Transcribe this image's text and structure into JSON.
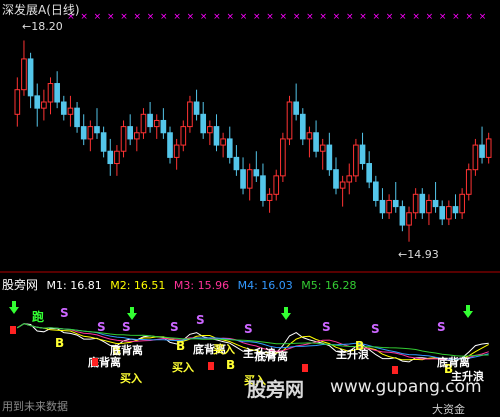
{
  "header": {
    "title": "深发展A(日线)"
  },
  "price_panel": {
    "high_label": "18.20",
    "low_label": "14.93",
    "x_marks_color": "#ff00ff"
  },
  "ma_legend": {
    "panel_name": "股旁网",
    "items": [
      {
        "label": "M1: 16.81",
        "color": "#ffffff"
      },
      {
        "label": "M2: 16.51",
        "color": "#ffff00"
      },
      {
        "label": "M3: 15.96",
        "color": "#ff3399"
      },
      {
        "label": "M4: 16.03",
        "color": "#3399ff"
      },
      {
        "label": "M5: 16.28",
        "color": "#33cc33"
      }
    ]
  },
  "signals": {
    "labels": [
      "跑",
      "S",
      "S",
      "S",
      "S",
      "S",
      "S",
      "S",
      "S",
      "S",
      "B",
      "B",
      "B",
      "B",
      "B",
      "B",
      "底背离",
      "底背离",
      "底背离",
      "底背离",
      "底背离",
      "主升浪",
      "主升浪",
      "主升浪",
      "买入",
      "买入",
      "买入",
      "买入"
    ]
  },
  "watermark": {
    "brand": "股旁网",
    "url": "www.gupang.com"
  },
  "footer": {
    "left_text": "用到未来数据",
    "right_text": "大资金"
  },
  "colors": {
    "up": "#ff3333",
    "down": "#54c6ea",
    "background": "#000000"
  },
  "chart_data": {
    "type": "candlestick",
    "title": "深发展A(日线)",
    "annotations": [
      {
        "text": "18.20",
        "kind": "high"
      },
      {
        "text": "14.93",
        "kind": "low"
      }
    ],
    "ylim": [
      14.6,
      18.5
    ],
    "candles": [
      [
        17.0,
        17.6,
        16.8,
        17.4
      ],
      [
        17.4,
        18.2,
        17.3,
        17.9
      ],
      [
        17.9,
        18.0,
        17.1,
        17.3
      ],
      [
        17.3,
        17.5,
        16.8,
        17.1
      ],
      [
        17.1,
        17.4,
        16.9,
        17.2
      ],
      [
        17.2,
        17.6,
        17.0,
        17.5
      ],
      [
        17.5,
        17.7,
        17.1,
        17.2
      ],
      [
        17.2,
        17.3,
        16.9,
        17.0
      ],
      [
        17.0,
        17.3,
        16.8,
        17.1
      ],
      [
        17.1,
        17.2,
        16.7,
        16.8
      ],
      [
        16.8,
        17.0,
        16.5,
        16.6
      ],
      [
        16.6,
        16.9,
        16.4,
        16.8
      ],
      [
        16.8,
        17.1,
        16.6,
        16.7
      ],
      [
        16.7,
        16.8,
        16.3,
        16.4
      ],
      [
        16.4,
        16.6,
        16.0,
        16.2
      ],
      [
        16.2,
        16.5,
        16.0,
        16.4
      ],
      [
        16.4,
        16.9,
        16.3,
        16.8
      ],
      [
        16.8,
        17.0,
        16.5,
        16.6
      ],
      [
        16.6,
        16.8,
        16.4,
        16.7
      ],
      [
        16.7,
        17.1,
        16.6,
        17.0
      ],
      [
        17.0,
        17.2,
        16.7,
        16.8
      ],
      [
        16.8,
        17.0,
        16.6,
        16.9
      ],
      [
        16.9,
        17.1,
        16.6,
        16.7
      ],
      [
        16.7,
        16.8,
        16.2,
        16.3
      ],
      [
        16.3,
        16.6,
        16.1,
        16.5
      ],
      [
        16.5,
        16.9,
        16.4,
        16.8
      ],
      [
        16.8,
        17.3,
        16.7,
        17.2
      ],
      [
        17.2,
        17.4,
        16.9,
        17.0
      ],
      [
        17.0,
        17.2,
        16.6,
        16.7
      ],
      [
        16.7,
        16.9,
        16.5,
        16.8
      ],
      [
        16.8,
        17.0,
        16.4,
        16.5
      ],
      [
        16.5,
        16.7,
        16.3,
        16.6
      ],
      [
        16.6,
        16.8,
        16.2,
        16.3
      ],
      [
        16.3,
        16.5,
        16.0,
        16.1
      ],
      [
        16.1,
        16.3,
        15.7,
        15.8
      ],
      [
        15.8,
        16.2,
        15.6,
        16.1
      ],
      [
        16.1,
        16.4,
        15.9,
        16.0
      ],
      [
        16.0,
        16.2,
        15.5,
        15.6
      ],
      [
        15.6,
        15.8,
        15.4,
        15.7
      ],
      [
        15.7,
        16.1,
        15.6,
        16.0
      ],
      [
        16.0,
        16.7,
        15.9,
        16.6
      ],
      [
        16.6,
        17.3,
        16.5,
        17.2
      ],
      [
        17.2,
        17.5,
        16.9,
        17.0
      ],
      [
        17.0,
        17.1,
        16.5,
        16.6
      ],
      [
        16.6,
        16.8,
        16.3,
        16.7
      ],
      [
        16.7,
        16.9,
        16.3,
        16.4
      ],
      [
        16.4,
        16.6,
        16.1,
        16.5
      ],
      [
        16.5,
        16.7,
        16.0,
        16.1
      ],
      [
        16.1,
        16.3,
        15.7,
        15.8
      ],
      [
        15.8,
        16.0,
        15.5,
        15.9
      ],
      [
        15.9,
        16.2,
        15.7,
        16.0
      ],
      [
        16.0,
        16.6,
        15.9,
        16.5
      ],
      [
        16.5,
        16.7,
        16.1,
        16.2
      ],
      [
        16.2,
        16.4,
        15.8,
        15.9
      ],
      [
        15.9,
        16.0,
        15.5,
        15.6
      ],
      [
        15.6,
        15.8,
        15.3,
        15.4
      ],
      [
        15.4,
        15.7,
        15.3,
        15.6
      ],
      [
        15.6,
        15.9,
        15.4,
        15.5
      ],
      [
        15.5,
        15.6,
        15.1,
        15.2
      ],
      [
        15.2,
        15.5,
        14.93,
        15.4
      ],
      [
        15.4,
        15.8,
        15.3,
        15.7
      ],
      [
        15.7,
        15.8,
        15.3,
        15.4
      ],
      [
        15.4,
        15.7,
        15.2,
        15.6
      ],
      [
        15.6,
        15.9,
        15.4,
        15.5
      ],
      [
        15.5,
        15.6,
        15.2,
        15.3
      ],
      [
        15.3,
        15.6,
        15.2,
        15.5
      ],
      [
        15.5,
        15.7,
        15.3,
        15.4
      ],
      [
        15.4,
        15.8,
        15.3,
        15.7
      ],
      [
        15.7,
        16.2,
        15.6,
        16.1
      ],
      [
        16.1,
        16.6,
        16.0,
        16.5
      ],
      [
        16.5,
        16.8,
        16.2,
        16.3
      ],
      [
        16.3,
        16.7,
        16.2,
        16.6
      ]
    ]
  }
}
